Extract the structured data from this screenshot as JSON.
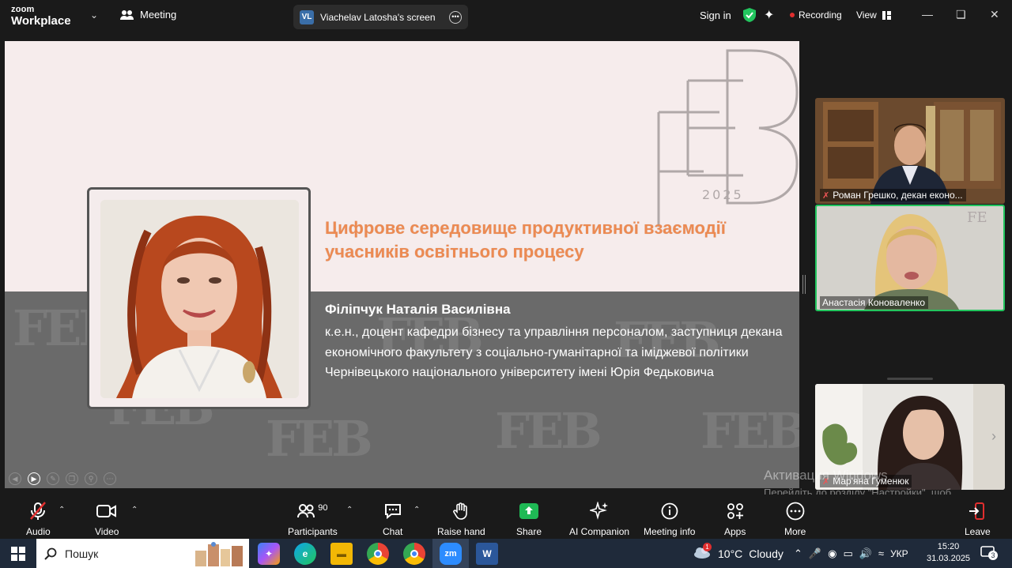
{
  "app": {
    "logo_top": "zoom",
    "logo_bottom": "Workplace",
    "meeting_label": "Meeting"
  },
  "screen_share": {
    "initials": "VL",
    "label": "Viachelav Latosha's screen"
  },
  "header_right": {
    "sign_in": "Sign in",
    "recording": "Recording",
    "view": "View"
  },
  "slide": {
    "logo_year": "2025",
    "title": "Цифрове середовище продуктивної взаємодії учасників освітнього процесу",
    "speaker_name": "Філіпчук Наталія Василівна",
    "speaker_desc": "к.е.н., доцент кафедри бізнесу та управління персоналом, заступниця декана економічного факультету з соціально-гуманітарної та іміджевої політики Чернівецького національного університету імені Юрія Федьковича"
  },
  "participants_tiles": [
    {
      "name": "Роман Грешко, декан еконо..."
    },
    {
      "name": "Анастасія Коноваленко"
    },
    {
      "name": "Мар'яна Гуменюк"
    }
  ],
  "watermark": {
    "line1": "Активация Windows",
    "line2": "Перейдіть до розділу \"Настройки\", щоб активувати Windows."
  },
  "toolbar": {
    "audio": "Audio",
    "video": "Video",
    "participants": "Participants",
    "participants_count": "90",
    "chat": "Chat",
    "raise_hand": "Raise hand",
    "share": "Share",
    "ai_companion": "AI Companion",
    "meeting_info": "Meeting info",
    "apps": "Apps",
    "more": "More",
    "leave": "Leave"
  },
  "taskbar": {
    "search": "Пошук",
    "weather_temp": "10°C",
    "weather_text": "Cloudy",
    "weather_badge": "1",
    "language": "УКР",
    "time": "15:20",
    "date": "31.03.2025",
    "notifications": "3"
  },
  "colors": {
    "accent_green": "#22c55e",
    "share_green": "#1fb955",
    "title_orange": "#ec8a52",
    "recording_red": "#e02e2e"
  }
}
